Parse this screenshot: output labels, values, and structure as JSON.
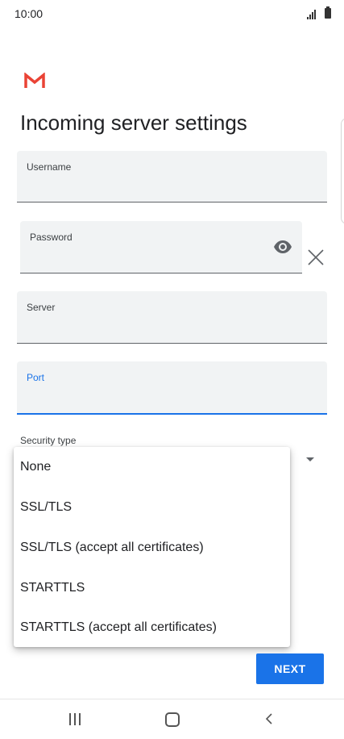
{
  "status_bar": {
    "time": "10:00"
  },
  "page": {
    "title": "Incoming server settings"
  },
  "fields": {
    "username": {
      "label": "Username",
      "value": ""
    },
    "password": {
      "label": "Password",
      "value": ""
    },
    "server": {
      "label": "Server",
      "value": ""
    },
    "port": {
      "label": "Port",
      "value": ""
    }
  },
  "security": {
    "label": "Security type",
    "options": [
      "None",
      "SSL/TLS",
      "SSL/TLS (accept all certificates)",
      "STARTTLS",
      "STARTTLS (accept all certificates)"
    ]
  },
  "actions": {
    "next_label": "NEXT"
  },
  "colors": {
    "accent": "#1a73e8",
    "gmail_red": "#ea4335"
  },
  "icons": [
    "gmail-logo",
    "eye-icon",
    "close-icon",
    "dropdown-arrow-icon",
    "recent-apps-icon",
    "home-icon",
    "back-icon"
  ]
}
